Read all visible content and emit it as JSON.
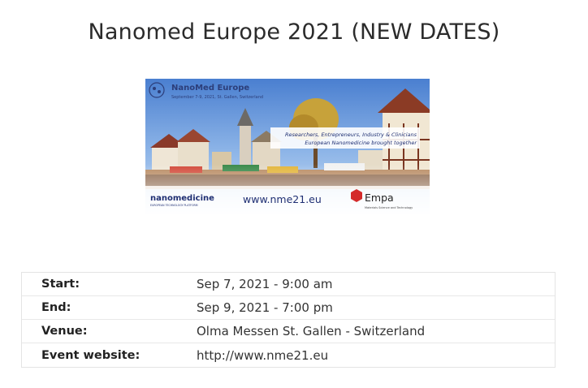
{
  "page": {
    "title": "Nanomed Europe 2021 (NEW DATES)"
  },
  "banner": {
    "heading": "NanoMed Europe",
    "subheading": "September 7-9, 2021, St. Gallen, Switzerland",
    "tagline_1": "Researchers, Entrepreneurs, Industry & Clinicians",
    "tagline_2": "European Nanomedicine brought together",
    "platform_name": "nanomedicine",
    "platform_sub": "EUROPEAN TECHNOLOGY PLATFORM",
    "url": "www.nme21.eu",
    "partner_name": "Empa",
    "partner_sub": "Materials Science and Technology"
  },
  "details": {
    "start_label": "Start:",
    "start_value": "Sep 7, 2021 - 9:00 am",
    "end_label": "End:",
    "end_value": "Sep 9, 2021 - 7:00 pm",
    "venue_label": "Venue:",
    "venue_value": "Olma Messen St. Gallen - Switzerland",
    "website_label": "Event website:",
    "website_value": "http://www.nme21.eu"
  }
}
